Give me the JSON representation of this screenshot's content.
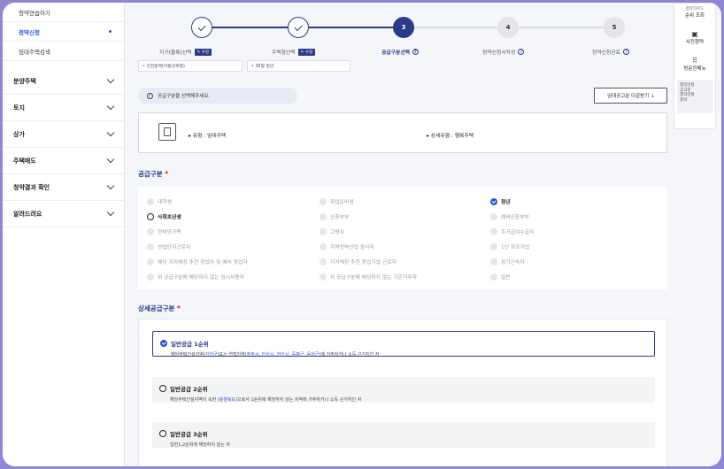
{
  "sidebar": {
    "sub_items": [
      {
        "label": "청약연습하기"
      },
      {
        "label": "청약신청"
      },
      {
        "label": "임대주택검색"
      }
    ],
    "nav_items": [
      {
        "label": "분양주택"
      },
      {
        "label": "토지"
      },
      {
        "label": "상가"
      },
      {
        "label": "주택매도"
      },
      {
        "label": "청약결과 확인"
      },
      {
        "label": "알려드려요"
      }
    ]
  },
  "stepper": {
    "steps": [
      {
        "number": "1",
        "label": "지구(블록)선택",
        "state": "done",
        "badge": "수정"
      },
      {
        "number": "2",
        "label": "주택형선택",
        "state": "done",
        "badge": "수정"
      },
      {
        "number": "3",
        "label": "공급구분선택",
        "state": "current"
      },
      {
        "number": "4",
        "label": "청약신청서작성",
        "state": "todo"
      },
      {
        "number": "5",
        "label": "청약신청완료",
        "state": "todo"
      }
    ],
    "selected_block": "• 진천문백(아홉장복형)",
    "selected_type": "• 36형 청년"
  },
  "info_message": "공급구분을 선택해주세요.",
  "notice_button": "임대공고문 다운받기",
  "type_card": {
    "type": "▸ 유형 : 임대주택",
    "detail_type": "▸ 상세유형 : 행복주택"
  },
  "supply": {
    "title": "공급구분",
    "required": "*",
    "options": [
      {
        "label": "대학생",
        "state": "disabled"
      },
      {
        "label": "취업준비생",
        "state": "disabled"
      },
      {
        "label": "청년",
        "state": "selected"
      },
      {
        "label": "사회초년생",
        "state": "enabled"
      },
      {
        "label": "신혼부부",
        "state": "disabled"
      },
      {
        "label": "예비신혼부부",
        "state": "disabled"
      },
      {
        "label": "한부모가족",
        "state": "disabled"
      },
      {
        "label": "고령자",
        "state": "disabled"
      },
      {
        "label": "주거급여수급자",
        "state": "disabled"
      },
      {
        "label": "산업단지근로자",
        "state": "disabled"
      },
      {
        "label": "지역전략산업 종사자",
        "state": "disabled"
      },
      {
        "label": "1인 창조기업",
        "state": "disabled"
      },
      {
        "label": "해당 지자체장 추천 창업자 및 예비 창업자",
        "state": "disabled"
      },
      {
        "label": "지자체장 추천 창업기업 근로자",
        "state": "disabled"
      },
      {
        "label": "장기근속자",
        "state": "disabled"
      },
      {
        "label": "위 공급구분에 해당하지 않는 임시사용자",
        "state": "disabled"
      },
      {
        "label": "위 공급구분에 해당하지 않는 기존거주자",
        "state": "disabled"
      },
      {
        "label": "일반",
        "state": "disabled"
      }
    ]
  },
  "detail_supply": {
    "title": "상세공급구분",
    "required": "*",
    "options": [
      {
        "label": "일반공급 1순위",
        "selected": true,
        "desc_parts": [
          "해당주택건설지역(",
          "진천군",
          ")또는 연접지역(",
          "청주시, 안성시, 천안시, 증평군, 음성군",
          ")에 거주하거나 소득 근거지인 자"
        ]
      },
      {
        "label": "일반공급 2순위",
        "selected": false,
        "desc_parts": [
          "해당주택건설지역이 속한 (",
          "충청북도",
          ")으로서 1순위에 해당하지 않는 지역에 거주하거나 소득 근거지인 자"
        ]
      },
      {
        "label": "일반공급 3순위",
        "selected": false,
        "desc_parts": [
          "일반1,2순위에 해당하지 않는 자"
        ]
      }
    ]
  },
  "quick_menu": {
    "top_partial": "청약가이드",
    "rank": "순위 조회",
    "photo": "사전청약",
    "all_menu": "방문한메뉴",
    "recent": [
      "청약신청",
      "공고문",
      "청약신청",
      "청약"
    ]
  },
  "colors": {
    "navy": "#2b3a8a",
    "accent_blue": "#2b59c3",
    "required_red": "#e02424",
    "frame_border": "#8f86d4"
  }
}
